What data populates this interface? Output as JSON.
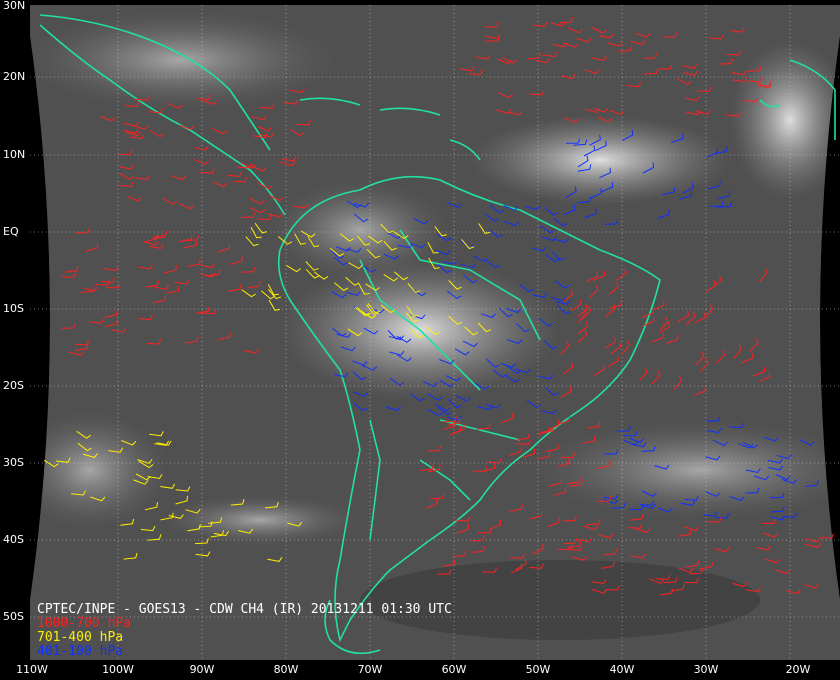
{
  "image": {
    "title": "CPTEC/INPE - GOES13 - CDW CH4 (IR) 20131211 01:30 UTC",
    "legend": [
      {
        "label": "1000-700 hPa",
        "color": "#ff2020"
      },
      {
        "label": "701-400 hPa",
        "color": "#ffee00"
      },
      {
        "label": "401-100 hPa",
        "color": "#1030ff"
      }
    ],
    "latitude_labels": [
      "30N",
      "20N",
      "10N",
      "EQ",
      "10S",
      "20S",
      "30S",
      "40S",
      "50S"
    ],
    "longitude_labels": [
      "110W",
      "100W",
      "90W",
      "80W",
      "70W",
      "60W",
      "50W",
      "40W",
      "30W",
      "20W"
    ],
    "colors": {
      "background": "#000000",
      "coastline": "#22e0a0",
      "grid": "#cccccc",
      "text": "#ffffff"
    }
  }
}
